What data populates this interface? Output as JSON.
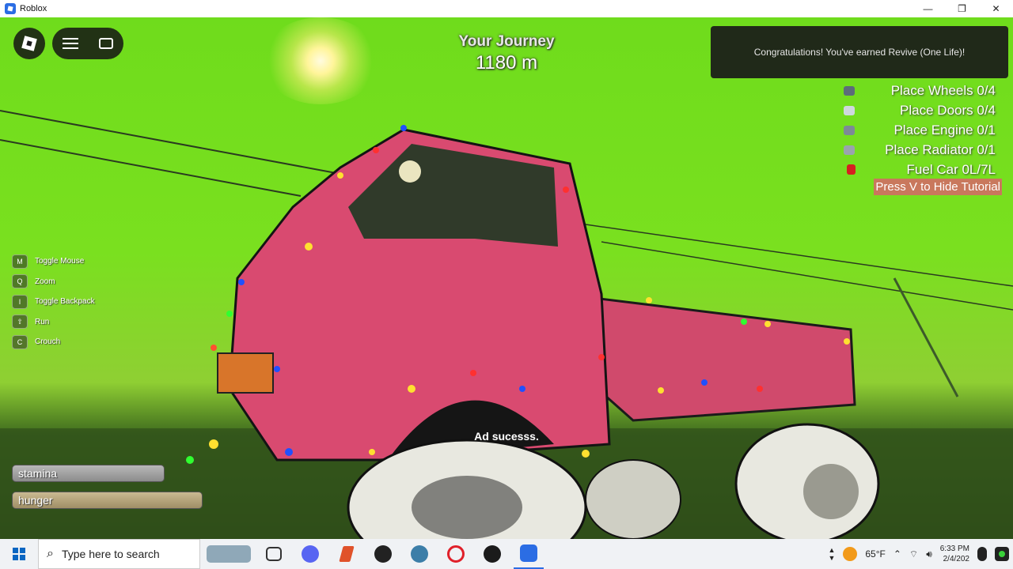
{
  "window": {
    "title": "Roblox",
    "minimize": "—",
    "maximize": "❐",
    "close": "✕"
  },
  "journey": {
    "label": "Your Journey",
    "value": "1180 m"
  },
  "notification": "Congratulations! You've earned Revive (One Life)!",
  "tutorial": {
    "items": [
      {
        "label": "Place Wheels 0/4",
        "color": "#5c6c7a"
      },
      {
        "label": "Place Doors 0/4",
        "color": "#cfd8dc"
      },
      {
        "label": "Place Engine 0/1",
        "color": "#7d8a96"
      },
      {
        "label": "Place Radiator 0/1",
        "color": "#9aa4ad"
      },
      {
        "label": "Fuel Car 0L/7L",
        "color": "#d62020"
      }
    ],
    "hide_hint": "Press V to Hide Tutorial"
  },
  "keybinds": [
    {
      "key": "M",
      "label": "Toggle Mouse"
    },
    {
      "key": "Q",
      "label": "Zoom"
    },
    {
      "key": "I",
      "label": "Toggle Backpack"
    },
    {
      "key": "⇧",
      "label": "Run"
    },
    {
      "key": "C",
      "label": "Crouch"
    }
  ],
  "bars": {
    "stamina": "stamina",
    "hunger": "hunger"
  },
  "ad_message": "Ad sucesss.",
  "taskbar": {
    "search_placeholder": "Type here to search",
    "temperature": "65°F",
    "time": "6:33 PM",
    "date": "2/4/202"
  }
}
